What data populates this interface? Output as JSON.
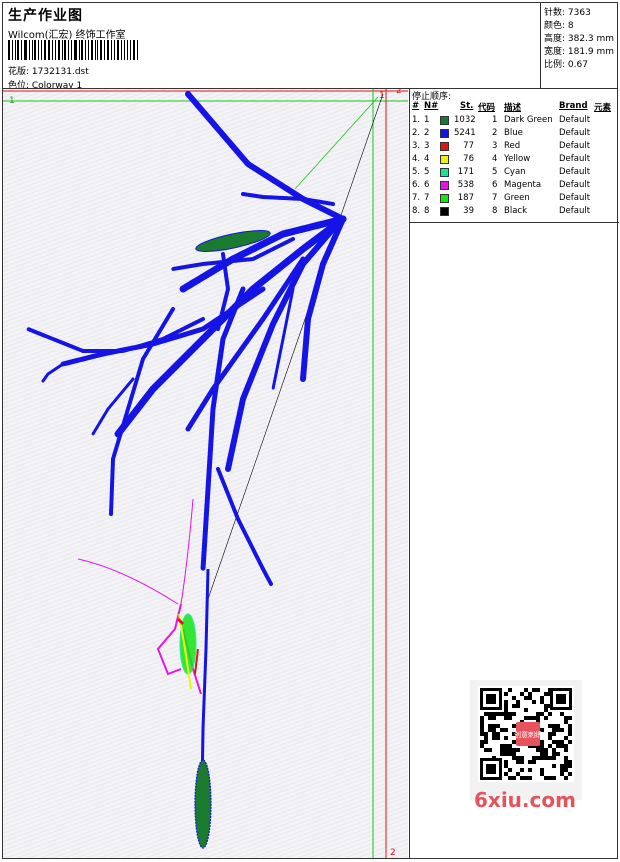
{
  "header": {
    "title": "生产作业图",
    "company": "Wilcom(汇宏) 终饰工作室",
    "design": "花版: 1732131.dst",
    "colorway": "色位: Colorway 1"
  },
  "stats": {
    "stitches": "针数: 7363",
    "colors": "颜色: 8",
    "height": "高度: 382.3 mm",
    "width": "宽度: 181.9 mm",
    "scale": "比例: 0.67"
  },
  "stop_sequence": {
    "title": "停止顺序:",
    "headers": {
      "hash": "#",
      "no": "N#",
      "st": "St.",
      "code": "代码",
      "desc": "描述",
      "brand": "Brand",
      "element": "元素"
    },
    "rows": [
      {
        "hash": "1.",
        "no": "1",
        "color": "#1a7a2e",
        "st": "1032",
        "code": "1",
        "desc": "Dark Green",
        "brand": "Default"
      },
      {
        "hash": "2.",
        "no": "2",
        "color": "#1414e6",
        "st": "5241",
        "code": "2",
        "desc": "Blue",
        "brand": "Default"
      },
      {
        "hash": "3.",
        "no": "3",
        "color": "#e61414",
        "st": "77",
        "code": "3",
        "desc": "Red",
        "brand": "Default"
      },
      {
        "hash": "4.",
        "no": "4",
        "color": "#f0f014",
        "st": "76",
        "code": "4",
        "desc": "Yellow",
        "brand": "Default"
      },
      {
        "hash": "5.",
        "no": "5",
        "color": "#14e68c",
        "st": "171",
        "code": "5",
        "desc": "Cyan",
        "brand": "Default"
      },
      {
        "hash": "6.",
        "no": "6",
        "color": "#e614e6",
        "st": "538",
        "code": "6",
        "desc": "Magenta",
        "brand": "Default"
      },
      {
        "hash": "7.",
        "no": "7",
        "color": "#14e614",
        "st": "187",
        "code": "7",
        "desc": "Green",
        "brand": "Default"
      },
      {
        "hash": "8.",
        "no": "8",
        "color": "#000000",
        "st": "39",
        "code": "8",
        "desc": "Black",
        "brand": "Default"
      }
    ]
  },
  "canvas": {
    "marker_1_top": "1",
    "marker_2_top": "2",
    "marker_1_corner": "1",
    "marker_2_bottom": "2"
  },
  "watermark": {
    "text": "6xiu.com",
    "qr_badge": "创意刺绣"
  }
}
